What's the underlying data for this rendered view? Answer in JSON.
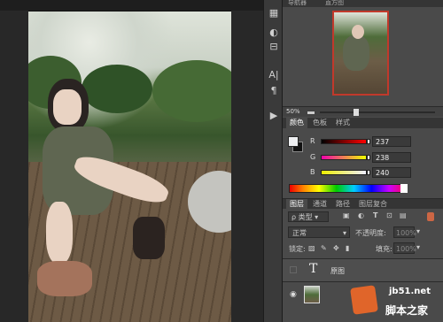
{
  "nav_panel": {
    "tabs": [
      "导航器",
      "直方图"
    ],
    "zoom": "50%"
  },
  "color_panel": {
    "tabs": [
      "颜色",
      "色板",
      "样式"
    ],
    "channels": [
      {
        "label": "R",
        "value": "237"
      },
      {
        "label": "G",
        "value": "238"
      },
      {
        "label": "B",
        "value": "240"
      }
    ]
  },
  "layers_panel": {
    "tabs": [
      "图层",
      "通道",
      "路径",
      "图层复合"
    ],
    "filter_label": "类型",
    "blend_mode": "正常",
    "opacity_label": "不透明度:",
    "opacity_value": "100%",
    "lock_label": "锁定:",
    "fill_label": "填充:",
    "fill_value": "100%",
    "layers": [
      {
        "name": "原图",
        "type": "T"
      },
      {
        "name": "",
        "type": "image"
      }
    ]
  },
  "watermark": {
    "line1": "jb51.net",
    "line2": "脚本之家"
  },
  "colors": {
    "accent_red": "#c1392b",
    "panel_bg": "#4a4a4a"
  }
}
